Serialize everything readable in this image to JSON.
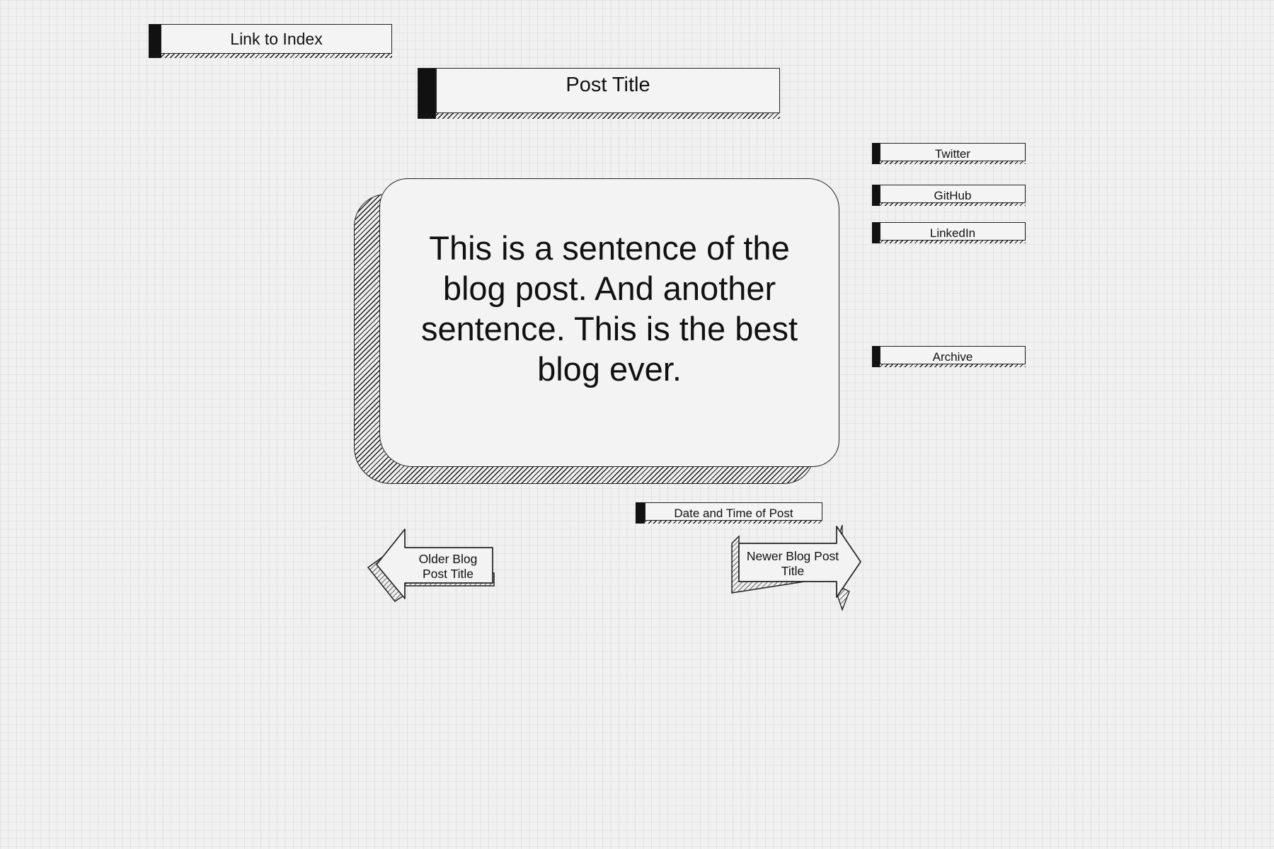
{
  "nav": {
    "index_link_label": "Link to Index",
    "post_title": "Post Title"
  },
  "social": {
    "items": [
      {
        "label": "Twitter"
      },
      {
        "label": "GitHub"
      },
      {
        "label": "LinkedIn"
      }
    ],
    "archive_label": "Archive"
  },
  "post": {
    "body": "This is a sentence of the blog post.  And another sentence.  This is the best blog ever.",
    "datetime_label": "Date and Time of Post"
  },
  "pager": {
    "older_label": "Older Blog Post Title",
    "newer_label": "Newer Blog Post Title"
  },
  "colors": {
    "background": "#f1f1f1",
    "grid": "#e2e2e2",
    "ink": "#111111"
  }
}
